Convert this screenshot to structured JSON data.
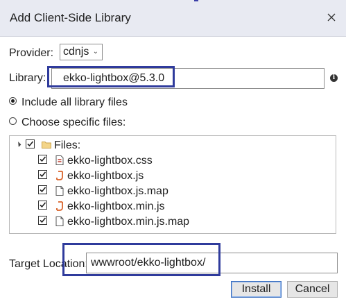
{
  "dialog": {
    "title": "Add Client-Side Library"
  },
  "provider": {
    "label": "Provider:",
    "value": "cdnjs"
  },
  "library": {
    "label": "Library:",
    "value": "ekko-lightbox@5.3.0",
    "info_icon": "info-icon"
  },
  "options": {
    "include_all": {
      "label": "Include all library files",
      "checked": true
    },
    "choose_specific": {
      "label": "Choose specific files:",
      "checked": false
    }
  },
  "tree": {
    "root": {
      "label": "Files:",
      "checked": true,
      "expanded": true,
      "icon": "folder-icon"
    },
    "files": [
      {
        "name": "ekko-lightbox.css",
        "checked": true,
        "icon": "css-file-icon"
      },
      {
        "name": "ekko-lightbox.js",
        "checked": true,
        "icon": "js-file-icon"
      },
      {
        "name": "ekko-lightbox.js.map",
        "checked": true,
        "icon": "file-icon"
      },
      {
        "name": "ekko-lightbox.min.js",
        "checked": true,
        "icon": "js-file-icon"
      },
      {
        "name": "ekko-lightbox.min.js.map",
        "checked": true,
        "icon": "file-icon"
      }
    ]
  },
  "target": {
    "label": "Target Location:",
    "value": "wwwroot/ekko-lightbox/"
  },
  "buttons": {
    "install": "Install",
    "cancel": "Cancel"
  },
  "colors": {
    "highlight": "#2f3b9c",
    "titlebar": "#e8eaf2",
    "js_icon": "#d9632a",
    "css_icon": "#c0392b"
  }
}
